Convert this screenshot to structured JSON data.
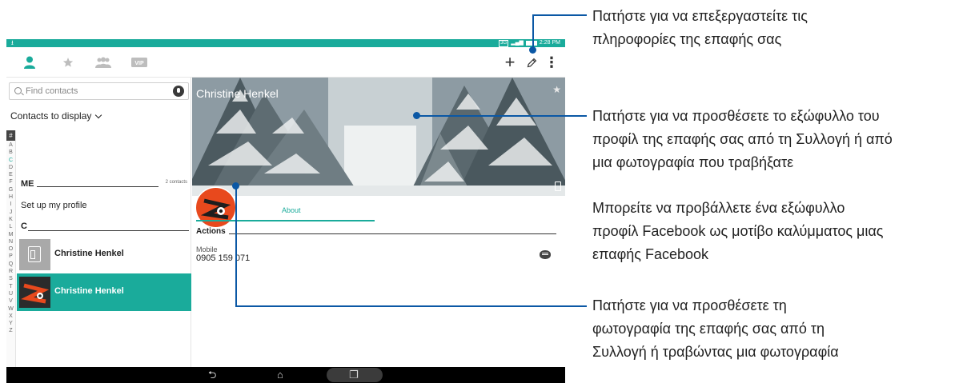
{
  "statusbar": {
    "signal_label": "3G",
    "time": "2:28 PM"
  },
  "toolbar": {
    "tabs": [
      {
        "name": "contacts",
        "icon": "person-icon"
      },
      {
        "name": "favorites",
        "icon": "star-icon"
      },
      {
        "name": "groups",
        "icon": "group-icon"
      },
      {
        "name": "vip",
        "icon": "vip-icon",
        "label": "VIP"
      }
    ],
    "add_symbol": "+",
    "menu_symbol": "⋮"
  },
  "left_panel": {
    "search_placeholder": "Find contacts",
    "contacts_to_display": "Contacts to display",
    "index_hash": "#",
    "index_letters": [
      "A",
      "B",
      "C",
      "D",
      "E",
      "F",
      "G",
      "H",
      "I",
      "J",
      "K",
      "L",
      "M",
      "N",
      "O",
      "P",
      "Q",
      "R",
      "S",
      "T",
      "U",
      "V",
      "W",
      "X",
      "Y",
      "Z"
    ],
    "section_me": "ME",
    "me_count": "2 contacts",
    "setup_profile": "Set up my profile",
    "section_c": "C",
    "contacts": [
      {
        "name": "Christine Henkel",
        "selected": false
      },
      {
        "name": "Christine Henkel",
        "selected": true
      }
    ]
  },
  "detail": {
    "name": "Christine Henkel",
    "tab_about": "About",
    "actions_header": "Actions",
    "phone_type": "Mobile",
    "phone_number": "0905 159 071"
  },
  "navbar": {
    "back": "⮌",
    "home": "⌂",
    "recent": "❐"
  },
  "callouts": {
    "edit": [
      "Πατήστε για να επεξεργαστείτε τις",
      "πληροφορίες της επαφής σας"
    ],
    "cover": [
      "Πατήστε για να προσθέσετε το εξώφυλλο του",
      "προφίλ της επαφής σας από τη Συλλογή ή από",
      "μια φωτογραφία που τραβήξατε"
    ],
    "facebook": [
      "Μπορείτε να προβάλλετε ένα εξώφυλλο",
      "προφίλ Facebook ως μοτίβο καλύμματος μιας",
      "επαφής Facebook"
    ],
    "photo": [
      "Πατήστε για να προσθέσετε τη",
      "φωτογραφία της επαφής σας από τη",
      "Συλλογή ή τραβώντας μια φωτογραφία"
    ]
  },
  "colors": {
    "accent_teal": "#1aab9b",
    "callout_blue": "#0b58a5",
    "avatar_orange": "#e8491d"
  }
}
